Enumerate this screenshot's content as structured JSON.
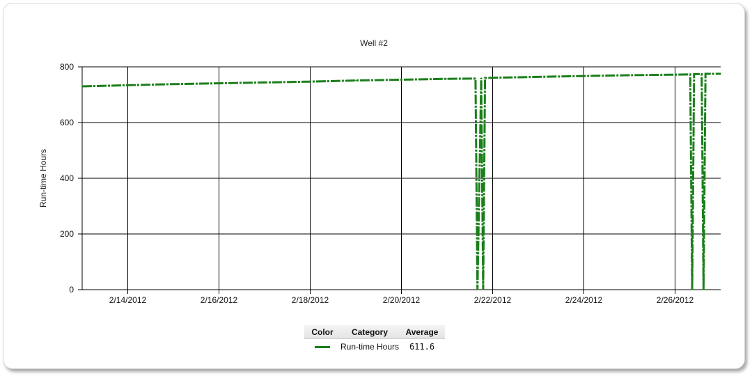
{
  "chart_data": {
    "type": "line",
    "title": "Well #2",
    "ylabel": "Run-time Hours",
    "xlabel": "",
    "ylim": [
      0,
      800
    ],
    "yticks": [
      0,
      200,
      400,
      600,
      800
    ],
    "xlim": [
      "2012-02-13 00:00",
      "2012-02-27 00:00"
    ],
    "xticks": [
      "2/14/2012",
      "2/16/2012",
      "2/18/2012",
      "2/20/2012",
      "2/22/2012",
      "2/24/2012",
      "2/26/2012"
    ],
    "grid": true,
    "series": [
      {
        "name": "Run-time Hours",
        "color": "#1a7f1a",
        "points": [
          [
            "2012-02-13 00:00",
            730
          ],
          [
            "2012-02-14 00:00",
            734
          ],
          [
            "2012-02-15 00:00",
            738
          ],
          [
            "2012-02-16 00:00",
            741
          ],
          [
            "2012-02-17 00:00",
            744
          ],
          [
            "2012-02-18 00:00",
            747
          ],
          [
            "2012-02-19 00:00",
            751
          ],
          [
            "2012-02-20 00:00",
            754
          ],
          [
            "2012-02-21 00:00",
            757
          ],
          [
            "2012-02-21 15:00",
            758
          ],
          [
            "2012-02-21 16:00",
            0
          ],
          [
            "2012-02-21 18:00",
            760
          ],
          [
            "2012-02-21 19:00",
            0
          ],
          [
            "2012-02-21 20:00",
            760
          ],
          [
            "2012-02-22 00:00",
            761
          ],
          [
            "2012-02-23 00:00",
            764
          ],
          [
            "2012-02-24 00:00",
            767
          ],
          [
            "2012-02-25 00:00",
            770
          ],
          [
            "2012-02-26 00:00",
            772
          ],
          [
            "2012-02-26 08:00",
            773
          ],
          [
            "2012-02-26 09:00",
            0
          ],
          [
            "2012-02-26 10:00",
            774
          ],
          [
            "2012-02-26 14:00",
            774
          ],
          [
            "2012-02-26 15:00",
            0
          ],
          [
            "2012-02-26 16:00",
            775
          ],
          [
            "2012-02-27 00:00",
            775
          ]
        ]
      }
    ]
  },
  "legend": {
    "headers": {
      "color": "Color",
      "category": "Category",
      "average": "Average"
    },
    "rows": [
      {
        "color": "#1a7f1a",
        "category": "Run-time Hours",
        "average": "611.6"
      }
    ]
  }
}
